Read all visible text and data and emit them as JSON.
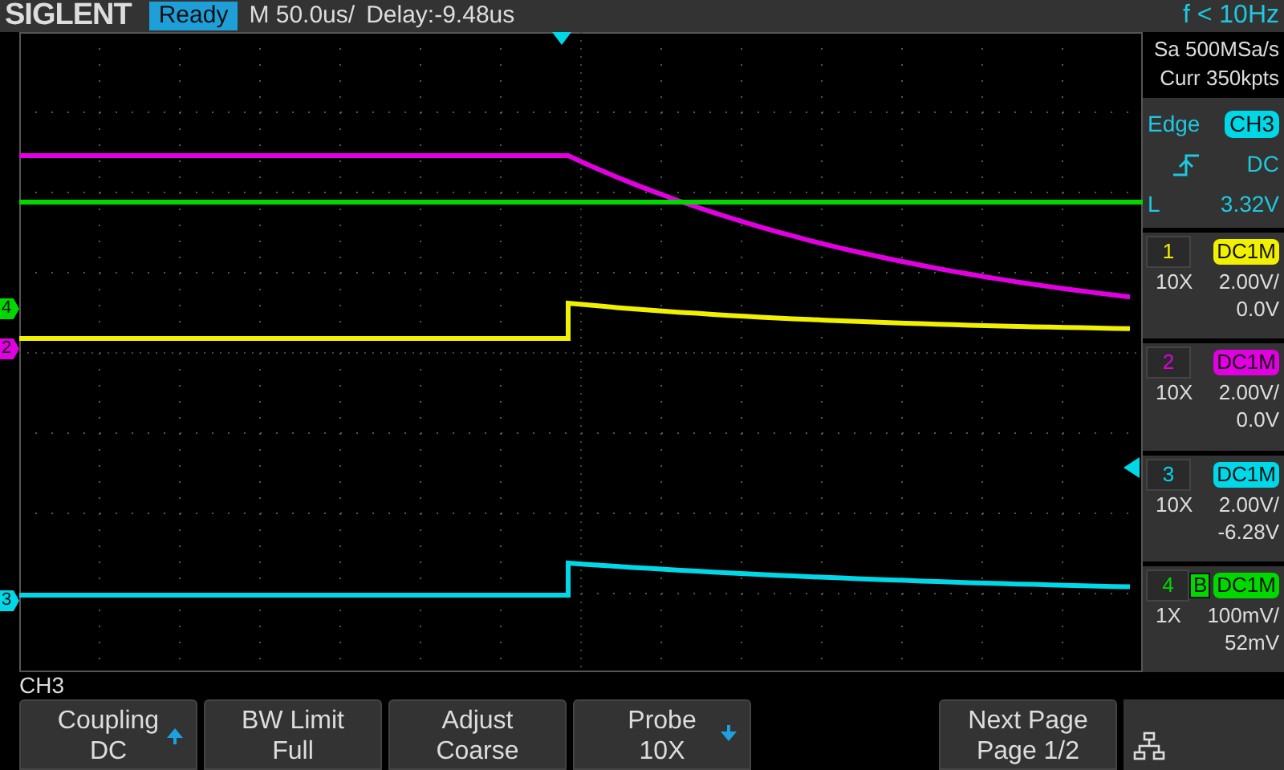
{
  "header": {
    "brand": "SIGLENT",
    "status": "Ready",
    "timebase": "M 50.0us/",
    "delay": "Delay:-9.48us",
    "frequency": "f < 10Hz"
  },
  "acquisition": {
    "sample_rate": "Sa 500MSa/s",
    "memory": "Curr 350kpts"
  },
  "trigger": {
    "type": "Edge",
    "source": {
      "label": "CH3",
      "color": "#00d8e8"
    },
    "coupling": "DC",
    "level_label": "L",
    "level_value": "3.32V"
  },
  "channels": [
    {
      "number": "1",
      "coupling": "DC1M",
      "probe": "10X",
      "scale": "2.00V/",
      "offset": "0.0V",
      "color": "#f0f000",
      "bw_limit": false
    },
    {
      "number": "2",
      "coupling": "DC1M",
      "probe": "10X",
      "scale": "2.00V/",
      "offset": "0.0V",
      "color": "#e000e0",
      "bw_limit": false
    },
    {
      "number": "3",
      "coupling": "DC1M",
      "probe": "10X",
      "scale": "2.00V/",
      "offset": "-6.28V",
      "color": "#00d8e8",
      "bw_limit": false
    },
    {
      "number": "4",
      "coupling": "DC1M",
      "probe": "1X",
      "scale": "100mV/",
      "offset": "52mV",
      "color": "#00d800",
      "bw_limit": true,
      "bw_label": "B"
    }
  ],
  "markers": [
    {
      "label": "4",
      "color": "#00d800"
    },
    {
      "label": "2",
      "color": "#e000e0"
    },
    {
      "label": "3",
      "color": "#00d8e8"
    }
  ],
  "menu": {
    "title": "CH3",
    "softkeys": [
      {
        "label": "Coupling",
        "value": "DC",
        "kind": "up"
      },
      {
        "label": "BW Limit",
        "value": "Full",
        "kind": "plain"
      },
      {
        "label": "Adjust",
        "value": "Coarse",
        "kind": "plain"
      },
      {
        "label": "Probe",
        "value": "10X",
        "kind": "down"
      },
      {
        "label": "Next Page",
        "value": "Page 1/2",
        "kind": "plain"
      }
    ]
  }
}
